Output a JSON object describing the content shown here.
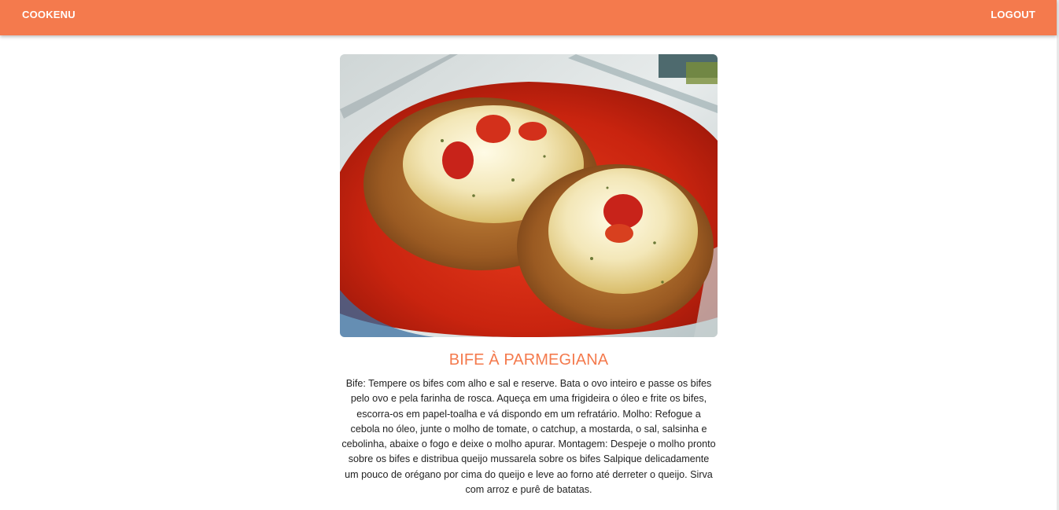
{
  "header": {
    "brand": "COOKENU",
    "logout": "LOGOUT",
    "color": "#f47a4d"
  },
  "recipe": {
    "title": "BIFE À PARMEGIANA",
    "description": "Bife: Tempere os bifes com alho e sal e reserve. Bata o ovo inteiro e passe os bifes pelo ovo e pela farinha de rosca. Aqueça em uma frigideira o óleo e frite os bifes, escorra-os em papel-toalha e vá dispondo em um refratário. Molho: Refogue a cebola no óleo, junte o molho de tomate, o catchup, a mostarda, o sal, salsinha e cebolinha, abaixe o fogo e deixe o molho apurar. Montagem: Despeje o molho pronto sobre os bifes e distribua queijo mussarela sobre os bifes Salpique delicadamente um pouco de orégano por cima do queijo e leve ao forno até derreter o queijo. Sirva com arroz e purê de batatas.",
    "title_color": "#f47a4d"
  }
}
